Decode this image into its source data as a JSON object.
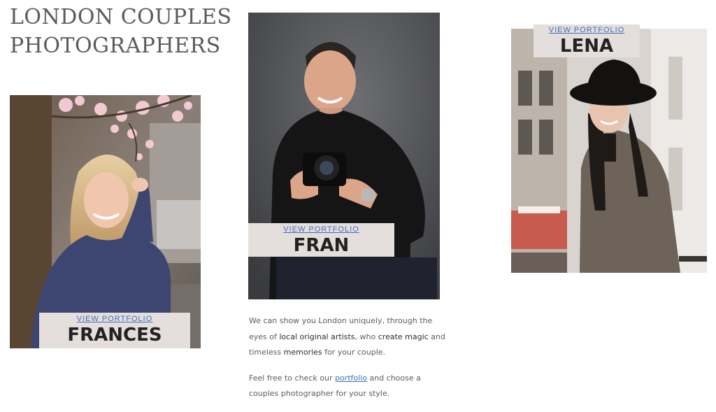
{
  "title": {
    "line1": "LONDON COUPLES",
    "line2": "PHOTOGRAPHERS"
  },
  "photographers": [
    {
      "name": "FRANCES",
      "link": "VIEW PORTFOLIO",
      "photo": "woman-blonde-cherry-blossom-photo"
    },
    {
      "name": "FRAN",
      "link": "VIEW PORTFOLIO",
      "photo": "man-black-turtleneck-camera-photo"
    },
    {
      "name": "LENA",
      "link": "VIEW PORTFOLIO",
      "photo": "woman-black-hat-tweed-coat-photo"
    }
  ],
  "intro": {
    "p1_a": "We can show you London uniquely, through the eyes of ",
    "p1_b": "local original artists",
    "p1_c": ", who ",
    "p1_d": "create magic",
    "p1_e": " and timeless ",
    "p1_f": "memories",
    "p1_g": " for your couple.",
    "p2_a": "Feel free to check our ",
    "p2_link": "portfolio",
    "p2_b": " and choose a couples photographer for your style."
  },
  "colors": {
    "label_bg": "#e4dfdc",
    "link": "#3f6fbf",
    "title": "#5a5a5a"
  }
}
